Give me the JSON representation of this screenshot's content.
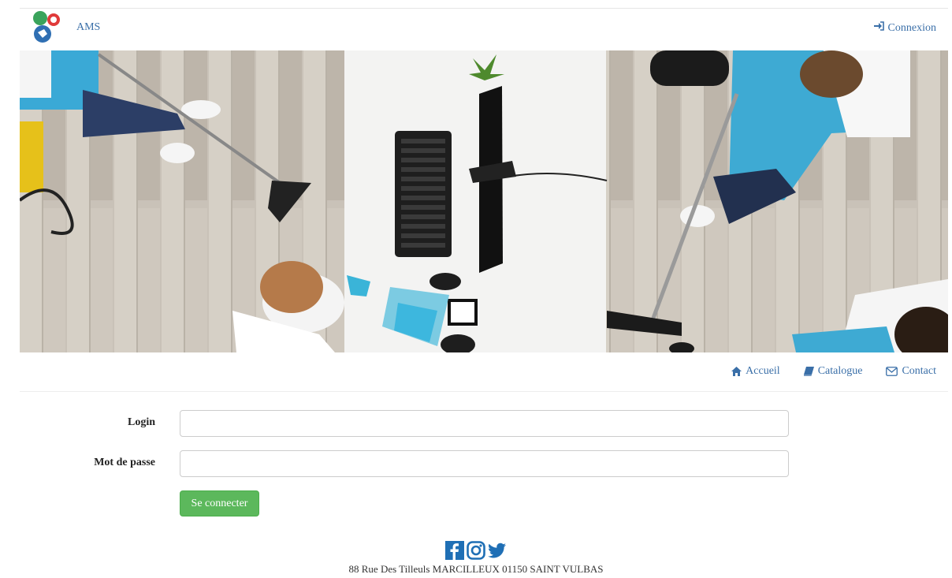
{
  "header": {
    "brand": "AMS",
    "login_link": "Connexion"
  },
  "subnav": {
    "items": [
      {
        "label": "Accueil",
        "icon": "home-icon"
      },
      {
        "label": "Catalogue",
        "icon": "book-icon"
      },
      {
        "label": "Contact",
        "icon": "envelope-icon"
      }
    ]
  },
  "form": {
    "login_label": "Login",
    "login_value": "",
    "password_label": "Mot de passe",
    "password_value": "",
    "submit_label": "Se connecter"
  },
  "footer": {
    "social": [
      "facebook-icon",
      "instagram-icon",
      "twitter-icon"
    ],
    "address": "88 Rue Des Tilleuls MARCILLEUX 01150 SAINT VULBAS"
  },
  "colors": {
    "link": "#3a6fa8",
    "button_green": "#5cb85c",
    "social_blue": "#1f6fb5"
  }
}
